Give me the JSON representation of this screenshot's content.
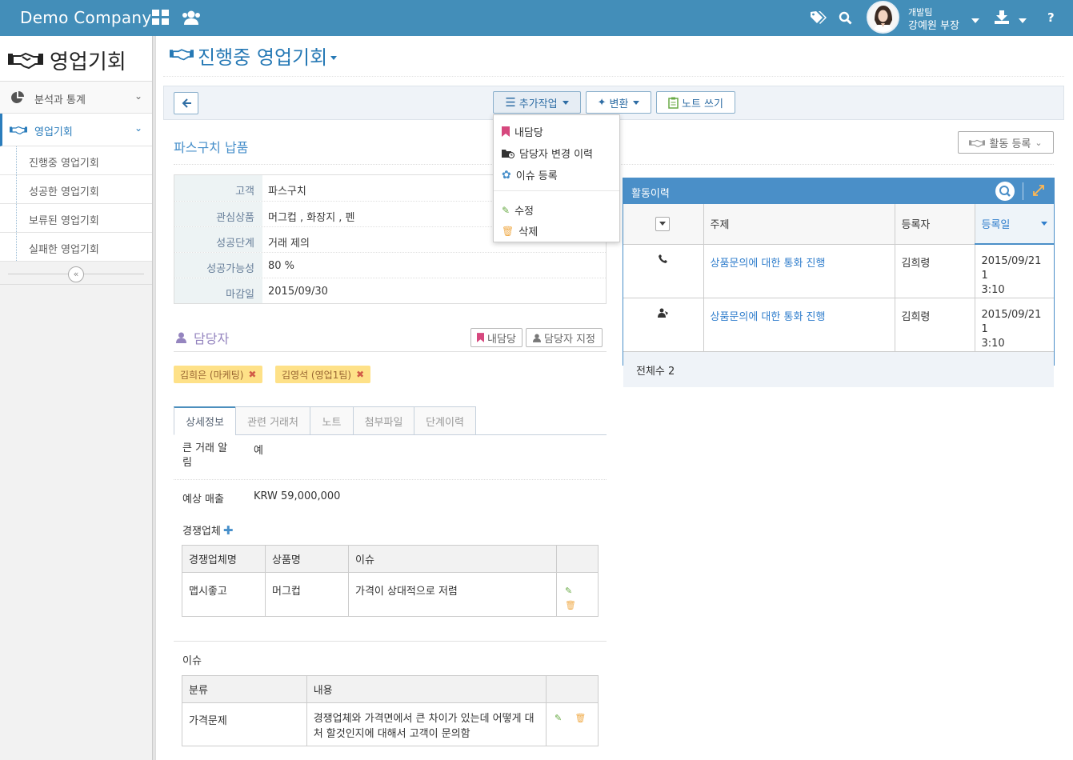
{
  "app": {
    "brand": "Demo Company",
    "user_team": "개발팀",
    "user_name": "강예원 부장"
  },
  "sidebar": {
    "title": "영업기회",
    "menus": [
      {
        "label": "분석과 통계"
      },
      {
        "label": "영업기회"
      }
    ],
    "subitems": [
      {
        "label": "진행중 영업기회"
      },
      {
        "label": "성공한 영업기회"
      },
      {
        "label": "보류된 영업기회"
      },
      {
        "label": "실패한 영업기회"
      }
    ]
  },
  "page": {
    "title": "진행중 영업기회"
  },
  "toolbar": {
    "more_label": "추가작업",
    "convert_label": "변환",
    "note_label": "노트 쓰기"
  },
  "dropdown": {
    "items": [
      "내담당",
      "담당자 변경 이력",
      "이슈 등록",
      "수정",
      "삭제"
    ]
  },
  "opportunity": {
    "name": "파스구치 납품",
    "fields": [
      {
        "label": "고객",
        "value": "파스구치"
      },
      {
        "label": "관심상품",
        "value": "머그컵 , 화장지 , 펜"
      },
      {
        "label": "성공단계",
        "value": "거래 제의"
      },
      {
        "label": "성공가능성",
        "value": "80 %"
      },
      {
        "label": "마감일",
        "value": "2015/09/30"
      }
    ]
  },
  "contacts": {
    "title": "담당자",
    "btn_mine": "내담당",
    "btn_assign": "담당자 지정",
    "tags": [
      "김희은 (마케팅)",
      "김영석 (영업1팀)"
    ]
  },
  "tabs": [
    "상세정보",
    "관련 거래처",
    "노트",
    "첨부파일",
    "단계이력"
  ],
  "details": {
    "big_deal_label": "큰 거래 알림",
    "big_deal_value": "예",
    "revenue_label": "예상 매출",
    "revenue_value": "KRW 59,000,000",
    "competitors_label": "경쟁업체",
    "competitor_headers": [
      "경쟁업체명",
      "상품명",
      "이슈"
    ],
    "competitors": [
      {
        "name": "맵시좋고",
        "product": "머그컵",
        "issue": "가격이 상대적으로 저렴"
      }
    ],
    "issues_label": "이슈",
    "issue_headers": [
      "분류",
      "내용"
    ],
    "issues": [
      {
        "category": "가격문제",
        "content": "경쟁업체와 가격면에서 큰 차이가 있는데 어떻게 대처 할것인지에 대해서 고객이 문의함"
      }
    ]
  },
  "activity": {
    "register_label": "활동 등록",
    "history_title": "활동이력",
    "headers": [
      "주제",
      "등록자",
      "등록일"
    ],
    "rows": [
      {
        "icon": "phone-icon",
        "subject": "상품문의에 대한 통화 진행",
        "author": "김희령",
        "date": "2015/09/21 1",
        "time": "3:10"
      },
      {
        "icon": "person-icon",
        "subject": "상품문의에 대한 통화 진행",
        "author": "김희령",
        "date": "2015/09/21 1",
        "time": "3:10"
      }
    ],
    "total": "전체수 2"
  }
}
